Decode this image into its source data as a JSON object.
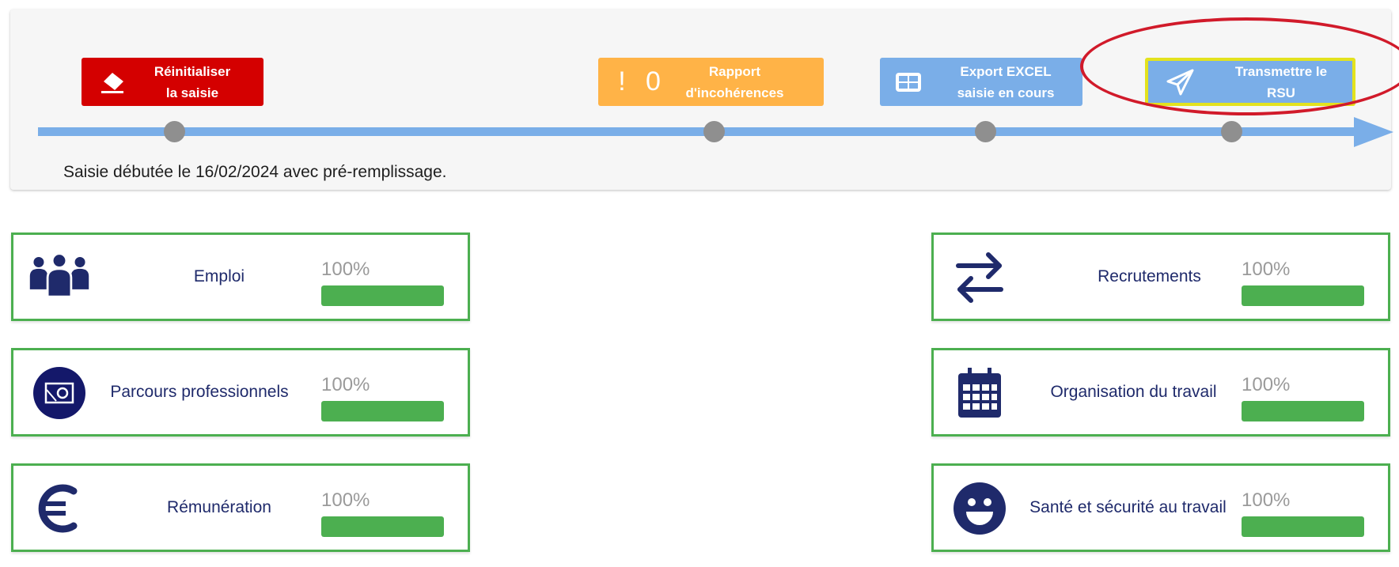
{
  "toolbar": {
    "reset_label": "Réinitialiser\nla saisie",
    "report_count": "0",
    "report_label": "Rapport\nd'incohérences",
    "export_label": "Export EXCEL\nsaisie en cours",
    "send_label": "Transmettre le\nRSU"
  },
  "info_text": "Saisie débutée le 16/02/2024 avec pré-remplissage.",
  "colors": {
    "reset": "#d40000",
    "report": "#ffb347",
    "export": "#7aaee8",
    "send": "#7aaee8",
    "highlight_border": "#e3e21e",
    "annotation_circle": "#d11a2a",
    "card_border": "#4caf50",
    "icon_navy": "#1f2a6b"
  },
  "sections": [
    {
      "title": "Emploi",
      "percent_label": "100%",
      "progress": 1.0,
      "icon": "people-group-icon"
    },
    {
      "title": "Recrutements",
      "percent_label": "100%",
      "progress": 1.0,
      "icon": "exchange-arrows-icon"
    },
    {
      "title": "Parcours professionnels",
      "percent_label": "100%",
      "progress": 1.0,
      "icon": "career-path-icon"
    },
    {
      "title": "Organisation du travail",
      "percent_label": "100%",
      "progress": 1.0,
      "icon": "calendar-icon"
    },
    {
      "title": "Rémunération",
      "percent_label": "100%",
      "progress": 1.0,
      "icon": "euro-icon"
    },
    {
      "title": "Santé et sécurité au travail",
      "percent_label": "100%",
      "progress": 1.0,
      "icon": "smiley-icon"
    }
  ]
}
